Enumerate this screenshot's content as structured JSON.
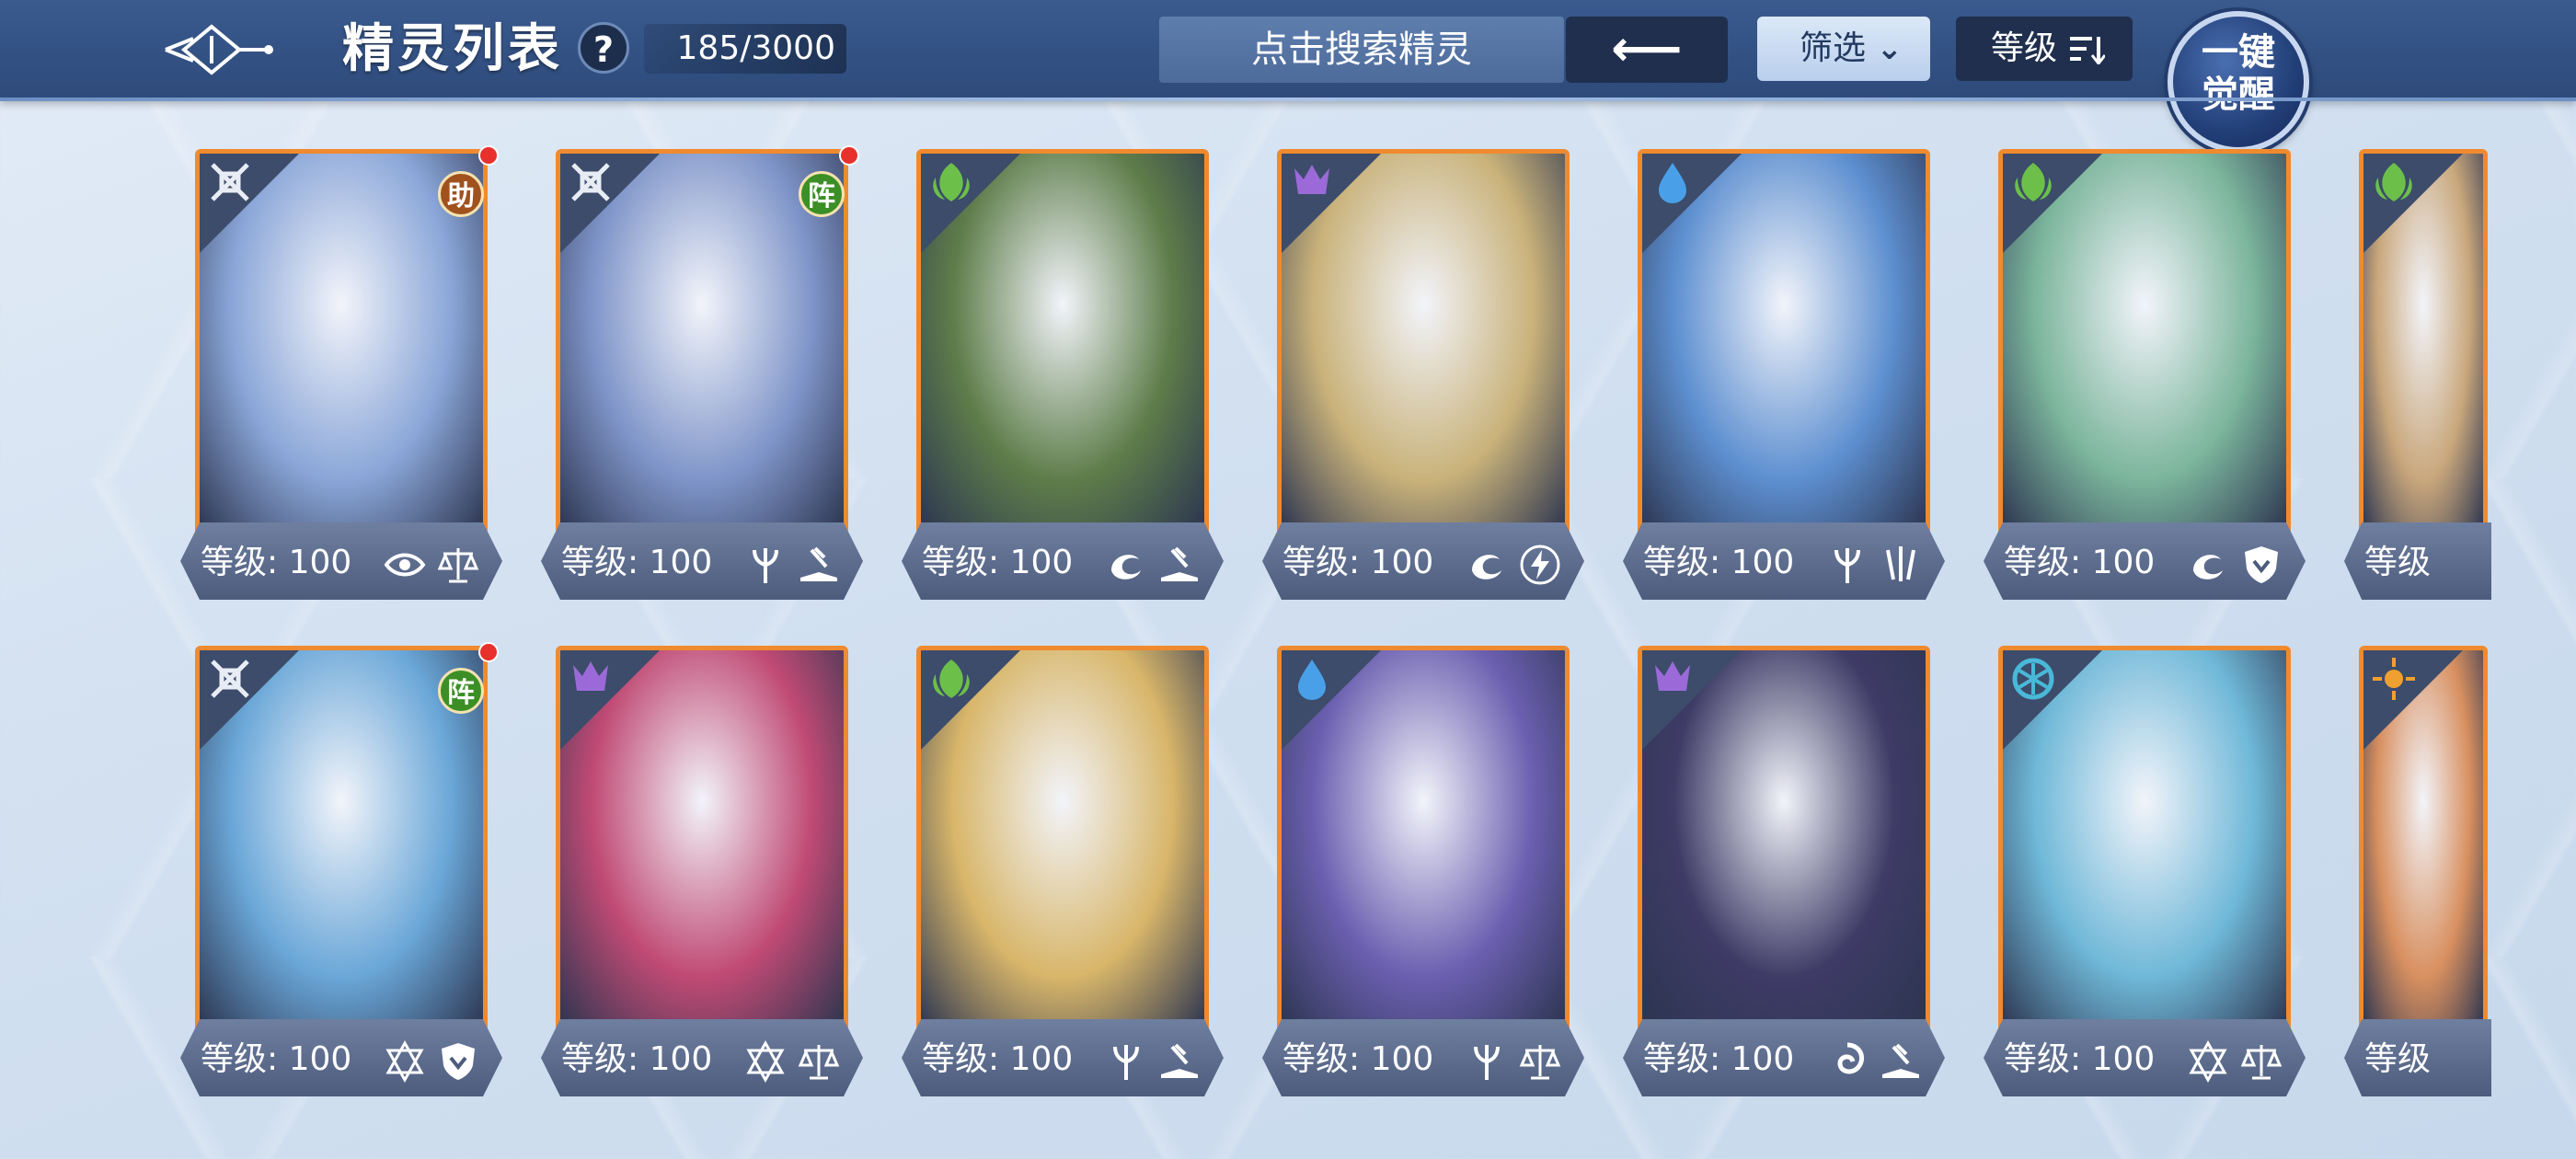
{
  "header": {
    "title": "精灵列表",
    "help": "?",
    "count": "185/3000",
    "search_placeholder": "点击搜索精灵",
    "back_arrow": "⟵",
    "filter_label": "筛选",
    "level_sort_label": "等级",
    "awaken": [
      "一键",
      "觉醒"
    ]
  },
  "colors": {
    "topbar": "#2d4a7a",
    "card_border": "#f08a2e",
    "badge_assist": "#a0521e",
    "badge_formation": "#3c8f26",
    "red_dot": "#e8302c"
  },
  "cards": [
    {
      "level": "等级: 100",
      "element": "neutral-icon",
      "badge": "助",
      "badge_type": "assist",
      "dot": true,
      "skills": [
        "eye-icon",
        "scale-icon"
      ],
      "art": "#8aa6d8"
    },
    {
      "level": "等级: 100",
      "element": "neutral-icon",
      "badge": "阵",
      "badge_type": "formation",
      "dot": true,
      "skills": [
        "trident-icon",
        "book-icon"
      ],
      "art": "#7f95c9"
    },
    {
      "level": "等级: 100",
      "element": "leaf-icon",
      "skills": [
        "dragon-icon",
        "book-icon"
      ],
      "art": "#5e7d4a"
    },
    {
      "level": "等级: 100",
      "element": "demon-icon",
      "skills": [
        "dragon-icon",
        "lightning-icon"
      ],
      "art": "#c9b27a"
    },
    {
      "level": "等级: 100",
      "element": "water-icon",
      "skills": [
        "trident-icon",
        "claw-icon"
      ],
      "art": "#5d8fd0"
    },
    {
      "level": "等级: 100",
      "element": "leaf-icon",
      "skills": [
        "dragon-icon",
        "shield-icon"
      ],
      "art": "#7bb59c"
    },
    {
      "level": "等级",
      "element": "leaf-icon",
      "skills": [],
      "art": "#c9a77c",
      "clipped": true
    },
    {
      "level": "等级: 100",
      "element": "neutral-icon",
      "badge": "阵",
      "badge_type": "formation",
      "dot": true,
      "skills": [
        "hexagram-icon",
        "shield-icon"
      ],
      "art": "#6aa7d8"
    },
    {
      "level": "等级: 100",
      "element": "demon-icon",
      "skills": [
        "hexagram-icon",
        "scale-icon"
      ],
      "art": "#c04a74"
    },
    {
      "level": "等级: 100",
      "element": "leaf-icon",
      "skills": [
        "trident-icon",
        "book-icon"
      ],
      "art": "#d8b66a"
    },
    {
      "level": "等级: 100",
      "element": "water-icon",
      "skills": [
        "trident-icon",
        "scale-icon"
      ],
      "art": "#6b5fb0"
    },
    {
      "level": "等级: 100",
      "element": "demon-icon",
      "skills": [
        "swirl-icon",
        "book-icon"
      ],
      "art": "#3e3b66"
    },
    {
      "level": "等级: 100",
      "element": "wind-icon",
      "skills": [
        "hexagram-icon",
        "scale-icon"
      ],
      "art": "#6fb8d8"
    },
    {
      "level": "等级",
      "element": "sun-icon",
      "skills": [],
      "art": "#d89060",
      "clipped": true
    }
  ]
}
